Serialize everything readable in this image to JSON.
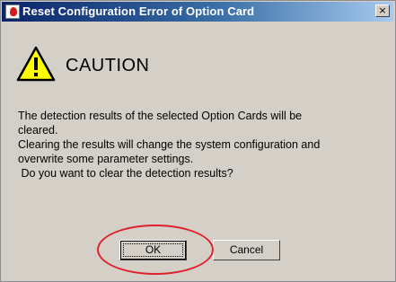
{
  "window": {
    "title": "Reset Configuration Error of Option Card",
    "close_glyph": "×"
  },
  "caution": {
    "icon": "warning-triangle-icon",
    "label": "CAUTION"
  },
  "message": {
    "lines": [
      "The detection results of the selected Option Cards will be",
      "cleared.",
      "Clearing the results will change the system configuration and",
      "overwrite some parameter settings.",
      " Do you want to clear the detection results?"
    ]
  },
  "buttons": {
    "ok_label": "OK",
    "cancel_label": "Cancel"
  },
  "colors": {
    "title_gradient_start": "#0a246a",
    "title_gradient_end": "#a6caf0",
    "dialog_background": "#d4d0c8",
    "warning_yellow": "#ffff00",
    "highlight_ring": "#e0202a"
  }
}
